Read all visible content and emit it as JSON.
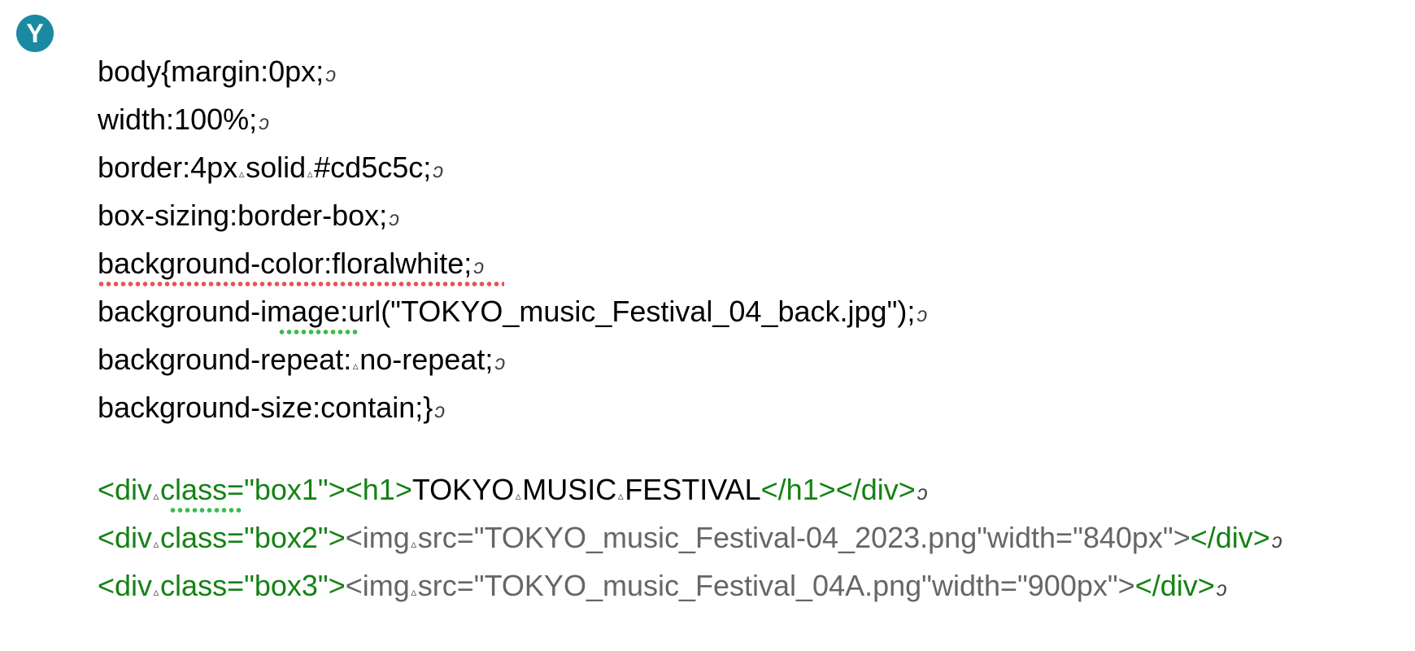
{
  "app": {
    "avatar_letter": "Y"
  },
  "glyphs": {
    "space": "▵",
    "newline": "ↄ"
  },
  "colors": {
    "tag": "#148214",
    "attribute": "#666666",
    "error_underline": "#e8534f",
    "suggestion_underline": "#3dbb4b"
  },
  "css_lines": [
    "body{margin:0px;",
    "width:100%;",
    "border:4px",
    "solid",
    "#cd5c5c;",
    "box-sizing:border-box;",
    "background-color:floralwhite;",
    "background-image:url(\"TOKYO_music_Festival_04_back.jpg\");",
    "background-repeat:",
    "no-repeat;",
    "background-size:contain;}"
  ],
  "html_lines": [
    {
      "open_div": "<div",
      "class_attr": "class=\"box1\">",
      "inner_tag": "<h1>",
      "text_1": "TOKYO",
      "text_2": "MUSIC",
      "text_3": "FESTIVAL",
      "close": "</h1></div>"
    },
    {
      "open_div": "<div",
      "class_attr": "class=\"box2\">",
      "img_open": "<img",
      "img_attrs": "src=\"TOKYO_music_Festival-04_2023.png\"width=\"840px\">",
      "close": "</div>"
    },
    {
      "open_div": "<div",
      "class_attr": "class=\"box3\">",
      "img_open": "<img",
      "img_attrs": "src=\"TOKYO_music_Festival_04A.png\"width=\"900px\">",
      "close": "</div>"
    }
  ]
}
